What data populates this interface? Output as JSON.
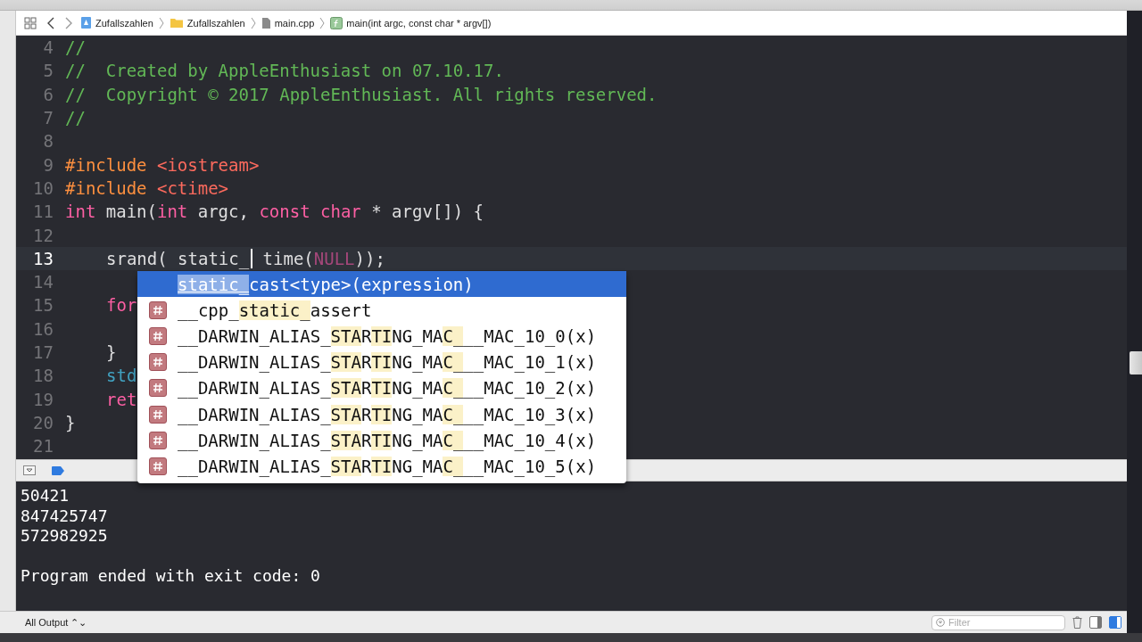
{
  "breadcrumb": [
    {
      "kind": "project",
      "label": "Zufallszahlen"
    },
    {
      "kind": "folder",
      "label": "Zufallszahlen"
    },
    {
      "kind": "file",
      "label": "main.cpp"
    },
    {
      "kind": "function",
      "label": "main(int argc, const char * argv[])"
    }
  ],
  "editor": {
    "lines": [
      {
        "number": "4",
        "current": false,
        "tokens": [
          {
            "kind": "comment",
            "text": "//"
          }
        ]
      },
      {
        "number": "5",
        "current": false,
        "tokens": [
          {
            "kind": "comment",
            "text": "//  Created by AppleEnthusiast on 07.10.17."
          }
        ]
      },
      {
        "number": "6",
        "current": false,
        "tokens": [
          {
            "kind": "comment",
            "text": "//  Copyright © 2017 AppleEnthusiast. All rights reserved."
          }
        ]
      },
      {
        "number": "7",
        "current": false,
        "tokens": [
          {
            "kind": "comment",
            "text": "//"
          }
        ]
      },
      {
        "number": "8",
        "current": false
      },
      {
        "number": "9",
        "current": false,
        "tokens": [
          {
            "kind": "preproc",
            "text": "#include"
          },
          {
            "kind": "string",
            "text": " <iostream>"
          }
        ]
      },
      {
        "number": "10",
        "current": false,
        "tokens": [
          {
            "kind": "preproc",
            "text": "#include"
          },
          {
            "kind": "string",
            "text": " <ctime>"
          }
        ]
      },
      {
        "number": "11",
        "current": false,
        "tokens": [
          {
            "kind": "keyword",
            "text": "int"
          },
          {
            "kind": "plain",
            "text": " main("
          },
          {
            "kind": "keyword",
            "text": "int"
          },
          {
            "kind": "plain",
            "text": " argc, "
          },
          {
            "kind": "keyword",
            "text": "const"
          },
          {
            "kind": "keyword",
            "text": " char"
          },
          {
            "kind": "plain",
            "text": " * argv[]) {"
          }
        ]
      },
      {
        "number": "12",
        "current": false
      },
      {
        "number": "13",
        "current": true,
        "indent": true,
        "tokens": [
          {
            "kind": "plain",
            "text": "srand( static_"
          },
          {
            "kind": "cursor"
          },
          {
            "kind": "plain",
            "text": " time("
          },
          {
            "kind": "macro",
            "text": "NULL"
          },
          {
            "kind": "plain",
            "text": "));"
          }
        ]
      },
      {
        "number": "14",
        "current": false
      },
      {
        "number": "15",
        "current": false,
        "indent": true,
        "tokens": [
          {
            "kind": "keyword",
            "text": "for"
          }
        ]
      },
      {
        "number": "16",
        "current": false
      },
      {
        "number": "17",
        "current": false,
        "indent": true,
        "tokens": [
          {
            "kind": "plain",
            "text": "}"
          }
        ]
      },
      {
        "number": "18",
        "current": false,
        "indent": true,
        "tokens": [
          {
            "kind": "type",
            "text": "std"
          }
        ]
      },
      {
        "number": "19",
        "current": false,
        "indent": true,
        "tokens": [
          {
            "kind": "keyword",
            "text": "ret"
          }
        ]
      },
      {
        "number": "20",
        "current": false,
        "tokens": [
          {
            "kind": "plain",
            "text": "}"
          }
        ]
      },
      {
        "number": "21",
        "current": false
      }
    ],
    "completions": [
      {
        "kind": "plain",
        "selected": true,
        "segments": [
          {
            "text": "static_",
            "match": true
          },
          {
            "text": "cast<type>(expression)",
            "match": false
          }
        ]
      },
      {
        "kind": "macro",
        "selected": false,
        "segments": [
          {
            "text": "__cpp_",
            "match": false
          },
          {
            "text": "static_",
            "match": true
          },
          {
            "text": "assert",
            "match": false
          }
        ]
      },
      {
        "kind": "macro",
        "selected": false,
        "segments": [
          {
            "text": "__DARWIN_ALIAS_",
            "match": false
          },
          {
            "text": "STA",
            "match": true
          },
          {
            "text": "R",
            "match": false
          },
          {
            "text": "TI",
            "match": true
          },
          {
            "text": "NG_MA",
            "match": false
          },
          {
            "text": "C_",
            "match": true
          },
          {
            "text": "__MAC_10_0(x)",
            "match": false
          }
        ]
      },
      {
        "kind": "macro",
        "selected": false,
        "segments": [
          {
            "text": "__DARWIN_ALIAS_",
            "match": false
          },
          {
            "text": "STA",
            "match": true
          },
          {
            "text": "R",
            "match": false
          },
          {
            "text": "TI",
            "match": true
          },
          {
            "text": "NG_MA",
            "match": false
          },
          {
            "text": "C_",
            "match": true
          },
          {
            "text": "__MAC_10_1(x)",
            "match": false
          }
        ]
      },
      {
        "kind": "macro",
        "selected": false,
        "segments": [
          {
            "text": "__DARWIN_ALIAS_",
            "match": false
          },
          {
            "text": "STA",
            "match": true
          },
          {
            "text": "R",
            "match": false
          },
          {
            "text": "TI",
            "match": true
          },
          {
            "text": "NG_MA",
            "match": false
          },
          {
            "text": "C_",
            "match": true
          },
          {
            "text": "__MAC_10_2(x)",
            "match": false
          }
        ]
      },
      {
        "kind": "macro",
        "selected": false,
        "segments": [
          {
            "text": "__DARWIN_ALIAS_",
            "match": false
          },
          {
            "text": "STA",
            "match": true
          },
          {
            "text": "R",
            "match": false
          },
          {
            "text": "TI",
            "match": true
          },
          {
            "text": "NG_MA",
            "match": false
          },
          {
            "text": "C_",
            "match": true
          },
          {
            "text": "__MAC_10_3(x)",
            "match": false
          }
        ]
      },
      {
        "kind": "macro",
        "selected": false,
        "segments": [
          {
            "text": "__DARWIN_ALIAS_",
            "match": false
          },
          {
            "text": "STA",
            "match": true
          },
          {
            "text": "R",
            "match": false
          },
          {
            "text": "TI",
            "match": true
          },
          {
            "text": "NG_MA",
            "match": false
          },
          {
            "text": "C_",
            "match": true
          },
          {
            "text": "__MAC_10_4(x)",
            "match": false
          }
        ]
      },
      {
        "kind": "macro",
        "selected": false,
        "segments": [
          {
            "text": "__DARWIN_ALIAS_",
            "match": false
          },
          {
            "text": "STA",
            "match": true
          },
          {
            "text": "R",
            "match": false
          },
          {
            "text": "TI",
            "match": true
          },
          {
            "text": "NG_MA",
            "match": false
          },
          {
            "text": "C_",
            "match": true
          },
          {
            "text": "__MAC_10_5(x)",
            "match": false
          }
        ]
      }
    ]
  },
  "console": {
    "output": [
      "50421",
      "847425747",
      "572982925"
    ],
    "status": "Program ended with exit code: 0"
  },
  "bottom_bar": {
    "output_selector": "All Output ⌃⌄",
    "filter": {
      "placeholder": "Filter"
    },
    "panes": [
      {
        "selected": false
      },
      {
        "selected": true
      }
    ]
  }
}
